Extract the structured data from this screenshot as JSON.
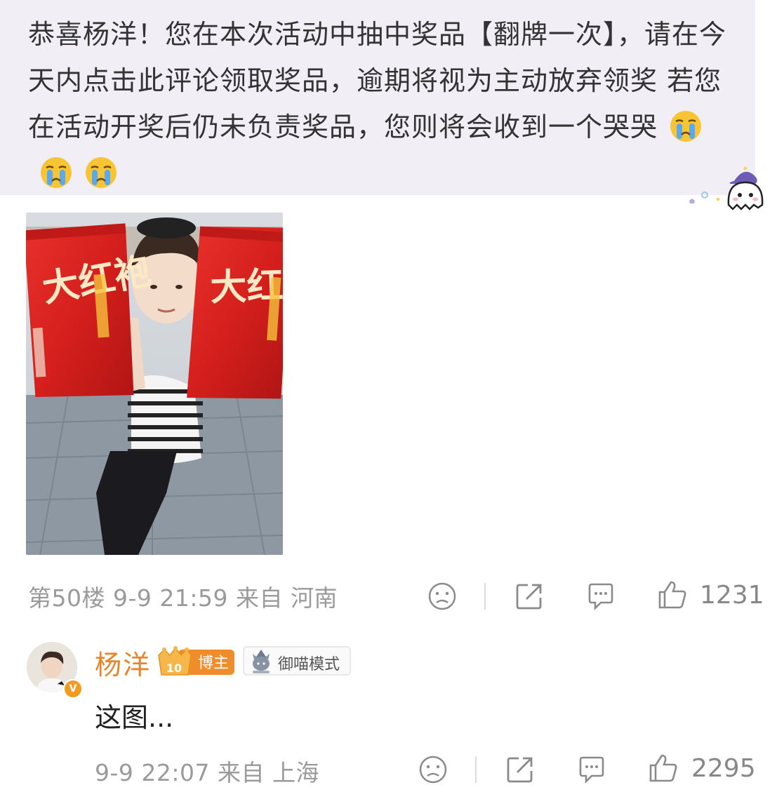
{
  "post": {
    "text": "恭喜杨洋！您在本次活动中抽中奖品【翻牌一次】，请在今天内点击此评论领取奖品，逾期将视为主动放弃领奖 若您在活动开奖后仍未负责奖品，您则将会收到一个哭哭",
    "emoji_icon": "crying-face-icon",
    "photo": {
      "package_text_left": "大红袍",
      "package_text_right": "大红袍"
    }
  },
  "comment_meta": {
    "text": "第50楼 9-9 21:59 来自 河南",
    "like_count": "1231"
  },
  "reply": {
    "username": "杨洋",
    "level": "10",
    "role_badge": "博主",
    "mode_badge": "御喵模式",
    "verified_mark": "V",
    "text": "这图...",
    "meta_text": "9-9 22:07 来自 上海",
    "like_count": "2295"
  },
  "colors": {
    "bubble_bg": "#f1eff5",
    "username": "#e8832a",
    "meta_gray": "#9a9a9a",
    "badge_orange": "#f29b1f"
  }
}
